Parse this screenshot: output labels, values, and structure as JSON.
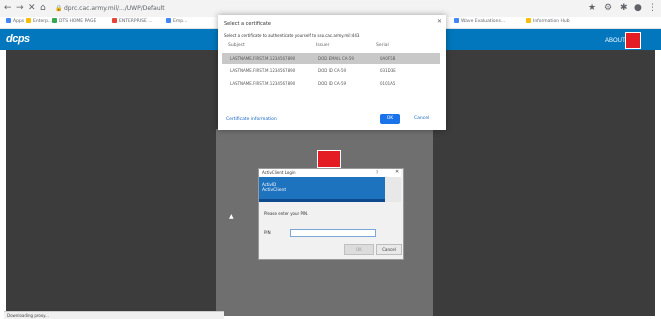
{
  "browser": {
    "url": "dprc.cac.army.mil/.../UWP/Default",
    "bookmarks": [
      {
        "label": "Apps",
        "color": "#4285f4"
      },
      {
        "label": "Enterp...",
        "color": "#fbbc05"
      },
      {
        "label": "DTS HOME PAGE",
        "color": "#34a853"
      },
      {
        "label": "ENTERPRISE ...",
        "color": "#ea4335"
      },
      {
        "label": "Emp...",
        "color": "#4285f4"
      },
      {
        "label": "Wave Evaluations...",
        "color": "#4285f4"
      },
      {
        "label": "Information Hub",
        "color": "#fbbc05"
      }
    ]
  },
  "app": {
    "logo": "dcps",
    "about_label": "ABOUT",
    "status_text": "Downloading proxy..."
  },
  "cert_dialog": {
    "title": "Select a certificate",
    "description": "Select a certificate to authenticate yourself to sso.cac.army.mil:443",
    "columns": [
      "Subject",
      "Issuer",
      "Serial"
    ],
    "rows": [
      {
        "subject": "LASTNAME.FIRST.M.1234567890",
        "issuer": "DOD EMAIL CA-59",
        "serial": "0A0F5B"
      },
      {
        "subject": "LASTNAME.FIRST.M.1234567890",
        "issuer": "DOD ID CA-59",
        "serial": "031D3E"
      },
      {
        "subject": "LASTNAME.FIRST.M.1234567890",
        "issuer": "DOD ID CA-59",
        "serial": "0101A5"
      }
    ],
    "info_link": "Certificate information",
    "ok_label": "OK",
    "cancel_label": "Cancel"
  },
  "pin_dialog": {
    "title": "ActivClient Login",
    "banner_line1": "ActivID",
    "banner_line2": "ActivClient",
    "prompt": "Please enter your PIN.",
    "pin_label": "PIN",
    "ok_label": "OK",
    "cancel_label": "Cancel"
  },
  "colors": {
    "appbar": "#0277bd",
    "usace_red": "#e41c23",
    "ok_blue": "#1a73e8",
    "selected_row": "#c8c8c8"
  }
}
